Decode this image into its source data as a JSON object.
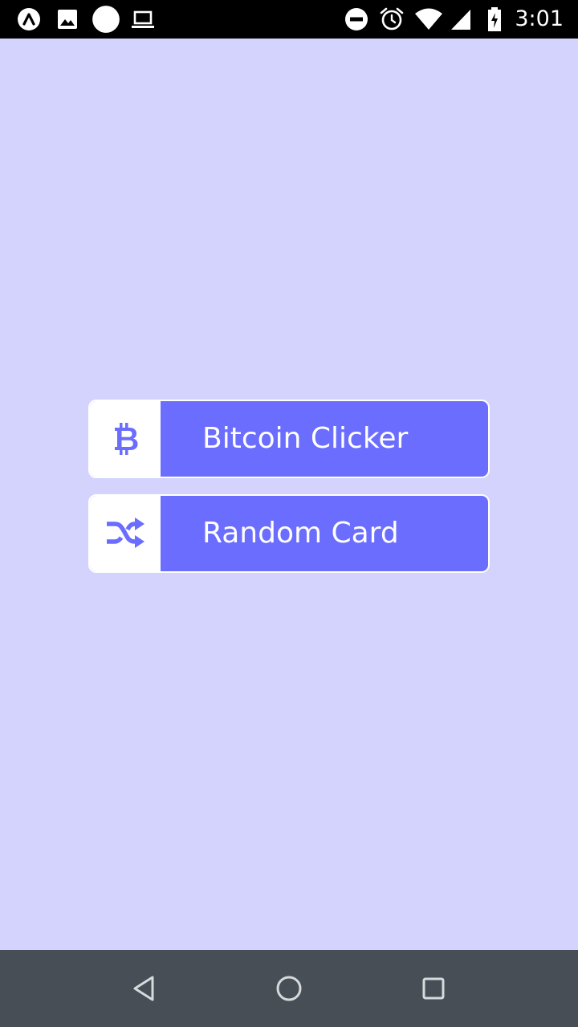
{
  "status_bar": {
    "time": "3:01",
    "left_icons": [
      "app-launcher-icon",
      "image-icon",
      "circle-notification-icon",
      "laptop-icon"
    ],
    "right_icons": [
      "do-not-disturb-icon",
      "alarm-icon",
      "wifi-icon",
      "cell-signal-icon",
      "battery-charging-icon"
    ]
  },
  "menu": {
    "buttons": [
      {
        "label": "Bitcoin Clicker",
        "icon": "bitcoin-icon"
      },
      {
        "label": "Random Card",
        "icon": "shuffle-icon"
      }
    ]
  },
  "nav_bar": {
    "buttons": [
      "back-icon",
      "home-icon",
      "recents-icon"
    ]
  },
  "colors": {
    "background": "#D3D3FD",
    "button": "#6B6DFE",
    "icon_box": "#FFFFFF",
    "status_bar": "#000000",
    "nav_bar": "#474E55"
  }
}
